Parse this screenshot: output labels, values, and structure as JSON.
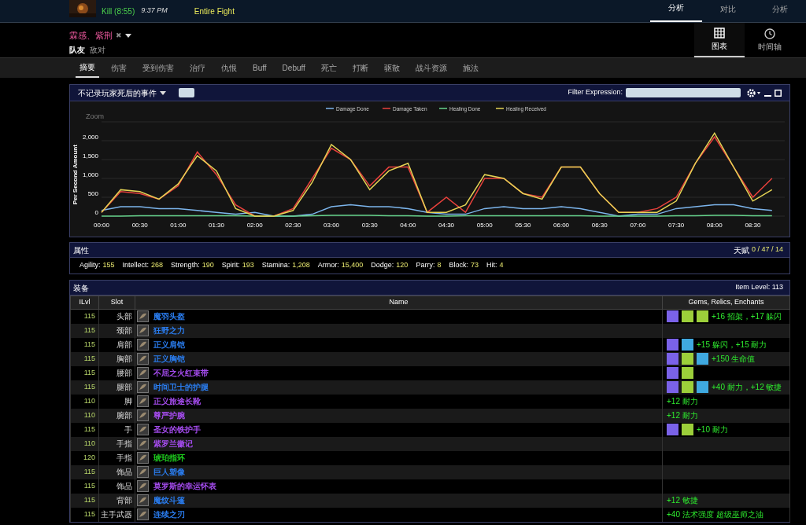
{
  "top_bar": {
    "result": "Kill (8:55)",
    "time": "9:37 PM",
    "fight": "Entire Fight",
    "nav_tabs": [
      {
        "label": "分析",
        "selected": true
      },
      {
        "label": "对比",
        "selected": false
      },
      {
        "label": "分析",
        "selected": false
      }
    ]
  },
  "player": {
    "name": "霖感、紫荆",
    "close": "✖",
    "filters": [
      {
        "label": "队友",
        "selected": true
      },
      {
        "label": "敌对",
        "selected": false
      }
    ],
    "view_tabs": [
      {
        "label": "图表",
        "kind": "grid",
        "selected": true
      },
      {
        "label": "时间轴",
        "kind": "clock",
        "selected": false
      }
    ]
  },
  "tabs": [
    {
      "label": "摘要",
      "selected": true
    },
    {
      "label": "伤害",
      "selected": false
    },
    {
      "label": "受到伤害",
      "selected": false
    },
    {
      "label": "治疗",
      "selected": false
    },
    {
      "label": "仇恨",
      "selected": false
    },
    {
      "label": "Buff",
      "selected": false
    },
    {
      "label": "Debuff",
      "selected": false
    },
    {
      "label": "死亡",
      "selected": false
    },
    {
      "label": "打断",
      "selected": false
    },
    {
      "label": "驱散",
      "selected": false
    },
    {
      "label": "战斗资源",
      "selected": false
    },
    {
      "label": "施法",
      "selected": false
    }
  ],
  "chart_panel": {
    "dropdown": "不记录玩家死后的事件",
    "filter_label": "Filter Expression:",
    "zoom_label": "Zoom",
    "chart_data": {
      "type": "line",
      "grid": true,
      "legend": true,
      "ylabel": "Per Second Amount",
      "x": [
        0,
        15,
        30,
        45,
        60,
        75,
        90,
        105,
        120,
        135,
        150,
        165,
        180,
        195,
        210,
        225,
        240,
        255,
        270,
        285,
        300,
        315,
        330,
        345,
        360,
        375,
        390,
        405,
        420,
        435,
        450,
        465,
        480,
        495,
        510,
        525
      ],
      "xlim": [
        0,
        535
      ],
      "ylim": [
        0,
        2500
      ],
      "xticks": [
        {
          "value": 0,
          "label": "00:00"
        },
        {
          "value": 30,
          "label": "00:30"
        },
        {
          "value": 60,
          "label": "01:00"
        },
        {
          "value": 90,
          "label": "01:30"
        },
        {
          "value": 120,
          "label": "02:00"
        },
        {
          "value": 150,
          "label": "02:30"
        },
        {
          "value": 180,
          "label": "03:00"
        },
        {
          "value": 210,
          "label": "03:30"
        },
        {
          "value": 240,
          "label": "04:00"
        },
        {
          "value": 270,
          "label": "04:30"
        },
        {
          "value": 300,
          "label": "05:00"
        },
        {
          "value": 330,
          "label": "05:30"
        },
        {
          "value": 360,
          "label": "06:00"
        },
        {
          "value": 390,
          "label": "06:30"
        },
        {
          "value": 420,
          "label": "07:00"
        },
        {
          "value": 450,
          "label": "07:30"
        },
        {
          "value": 480,
          "label": "08:00"
        },
        {
          "value": 510,
          "label": "08:30"
        }
      ],
      "yticks": [
        {
          "value": 0,
          "label": "0"
        },
        {
          "value": 500,
          "label": "500"
        },
        {
          "value": 1000,
          "label": "1,000"
        },
        {
          "value": 1500,
          "label": "1,500"
        },
        {
          "value": 2000,
          "label": "2,000"
        }
      ],
      "series": [
        {
          "name": "Damage Done",
          "color": "#7cb5ec",
          "values": [
            150,
            250,
            250,
            200,
            200,
            150,
            100,
            50,
            100,
            0,
            0,
            50,
            250,
            300,
            250,
            250,
            200,
            100,
            50,
            50,
            200,
            250,
            200,
            200,
            250,
            200,
            100,
            0,
            50,
            50,
            200,
            250,
            300,
            300,
            200,
            150
          ]
        },
        {
          "name": "Damage Taken",
          "color": "#e8413c",
          "values": [
            100,
            650,
            600,
            450,
            800,
            1700,
            1100,
            300,
            0,
            0,
            200,
            1000,
            1800,
            1500,
            800,
            1300,
            1300,
            100,
            500,
            100,
            1000,
            1000,
            600,
            500,
            1300,
            1300,
            600,
            100,
            100,
            200,
            500,
            1400,
            2100,
            1300,
            500,
            1000
          ]
        },
        {
          "name": "Healing Done",
          "color": "#66d38c",
          "values": [
            0,
            0,
            10,
            10,
            10,
            10,
            10,
            10,
            0,
            0,
            0,
            10,
            20,
            20,
            20,
            10,
            10,
            0,
            0,
            10,
            10,
            10,
            10,
            10,
            10,
            10,
            0,
            0,
            0,
            0,
            10,
            10,
            20,
            20,
            10,
            10
          ]
        },
        {
          "name": "Healing Received",
          "color": "#e4d354",
          "values": [
            100,
            700,
            650,
            450,
            850,
            1600,
            1200,
            200,
            0,
            0,
            150,
            900,
            1900,
            1500,
            700,
            1200,
            1400,
            100,
            100,
            300,
            1100,
            1000,
            600,
            450,
            1300,
            1300,
            600,
            100,
            100,
            100,
            400,
            1400,
            2200,
            1300,
            400,
            700
          ]
        }
      ]
    }
  },
  "attributes": {
    "title": "属性",
    "talent_label": "天赋",
    "talents": "0 / 47 / 14",
    "stats": [
      {
        "name": "Agility:",
        "value": "155"
      },
      {
        "name": "Intellect:",
        "value": "268"
      },
      {
        "name": "Strength:",
        "value": "190"
      },
      {
        "name": "Spirit:",
        "value": "193"
      },
      {
        "name": "Stamina:",
        "value": "1,208"
      },
      {
        "name": "Armor:",
        "value": "15,400"
      },
      {
        "name": "Dodge:",
        "value": "120"
      },
      {
        "name": "Parry:",
        "value": "8"
      },
      {
        "name": "Block:",
        "value": "73"
      },
      {
        "name": "Hit:",
        "value": "4"
      }
    ]
  },
  "equipment": {
    "title": "装备",
    "item_level": "Item Level: 113",
    "columns": [
      "ILvl",
      "Slot",
      "Name",
      "Gems, Relics, Enchants"
    ],
    "rows": [
      {
        "ilvl": "115",
        "slot": "头部",
        "name": "魔羽头盔",
        "color": "#2a7df0",
        "gems": [
          {
            "color": "#7a62e8"
          },
          {
            "color": "#9ccf3a"
          },
          {
            "color": "#9ccf3a"
          }
        ],
        "enchant": "+16 招架，+17 躲闪"
      },
      {
        "ilvl": "115",
        "slot": "颈部",
        "name": "狂野之力",
        "color": "#2a7df0"
      },
      {
        "ilvl": "115",
        "slot": "肩部",
        "name": "正义肩铠",
        "color": "#2a7df0",
        "gems": [
          {
            "color": "#7a62e8"
          },
          {
            "color": "#3fa9e0"
          }
        ],
        "enchant": "+15 躲闪，+15 耐力"
      },
      {
        "ilvl": "115",
        "slot": "胸部",
        "name": "正义胸铠",
        "color": "#2a7df0",
        "gems": [
          {
            "color": "#7a62e8"
          },
          {
            "color": "#9ccf3a"
          },
          {
            "color": "#3fa9e0"
          }
        ],
        "enchant": "+150 生命值"
      },
      {
        "ilvl": "115",
        "slot": "腰部",
        "name": "不屈之火红束带",
        "color": "#a64cf0",
        "gems": [
          {
            "color": "#7a62e8"
          },
          {
            "color": "#9ccf3a"
          }
        ]
      },
      {
        "ilvl": "115",
        "slot": "腿部",
        "name": "时间卫士的护腿",
        "color": "#2a7df0",
        "gems": [
          {
            "color": "#7a62e8"
          },
          {
            "color": "#9ccf3a"
          },
          {
            "color": "#3fa9e0"
          }
        ],
        "enchant": "+40 耐力，+12 敏捷"
      },
      {
        "ilvl": "110",
        "slot": "脚",
        "name": "正义旅途长靴",
        "color": "#a64cf0",
        "enchant": "+12 耐力"
      },
      {
        "ilvl": "110",
        "slot": "腕部",
        "name": "尊严护腕",
        "color": "#a64cf0",
        "enchant": "+12 耐力"
      },
      {
        "ilvl": "115",
        "slot": "手",
        "name": "圣女的铁护手",
        "color": "#a64cf0",
        "gems": [
          {
            "color": "#7a62e8"
          },
          {
            "color": "#9ccf3a"
          }
        ],
        "enchant": "+10 耐力"
      },
      {
        "ilvl": "110",
        "slot": "手指",
        "name": "紫罗兰徽记",
        "color": "#a64cf0"
      },
      {
        "ilvl": "120",
        "slot": "手指",
        "name": "琥珀指环",
        "color": "#1ed01e"
      },
      {
        "ilvl": "115",
        "slot": "饰品",
        "name": "巨人塑像",
        "color": "#2a7df0"
      },
      {
        "ilvl": "115",
        "slot": "饰品",
        "name": "莫罗斯的幸运怀表",
        "color": "#a64cf0"
      },
      {
        "ilvl": "115",
        "slot": "背部",
        "name": "魔纹斗篷",
        "color": "#2a7df0",
        "enchant": "+12 敏捷"
      },
      {
        "ilvl": "115",
        "slot": "主手武器",
        "name": "连续之刃",
        "color": "#2a7df0",
        "enchant": "+40 法术强度 超级巫师之油"
      }
    ]
  }
}
